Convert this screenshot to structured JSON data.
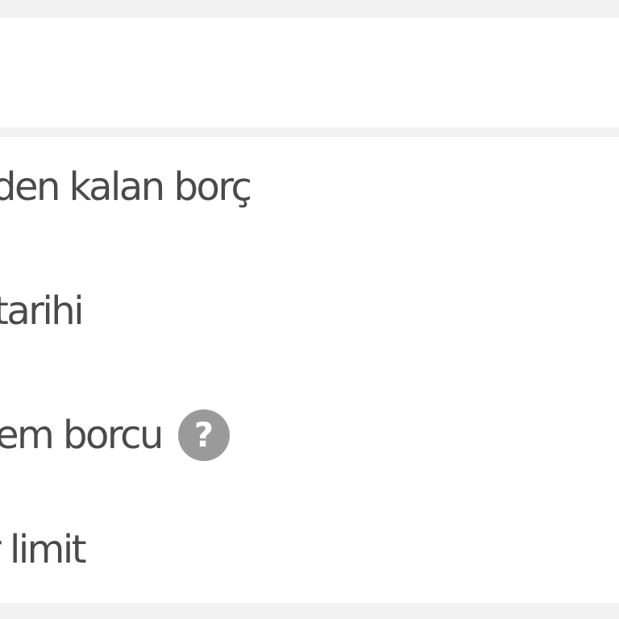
{
  "rows": [
    {
      "label": "den kalan borç"
    },
    {
      "label": "tarihi"
    },
    {
      "label": "em borcu",
      "help_icon": "question-circle-icon",
      "help_glyph": "?"
    },
    {
      "label": "r limit"
    }
  ],
  "colors": {
    "background": "#f2f2f2",
    "card": "#ffffff",
    "text": "#4a4a4a",
    "help_icon": "#9a9a9a"
  }
}
